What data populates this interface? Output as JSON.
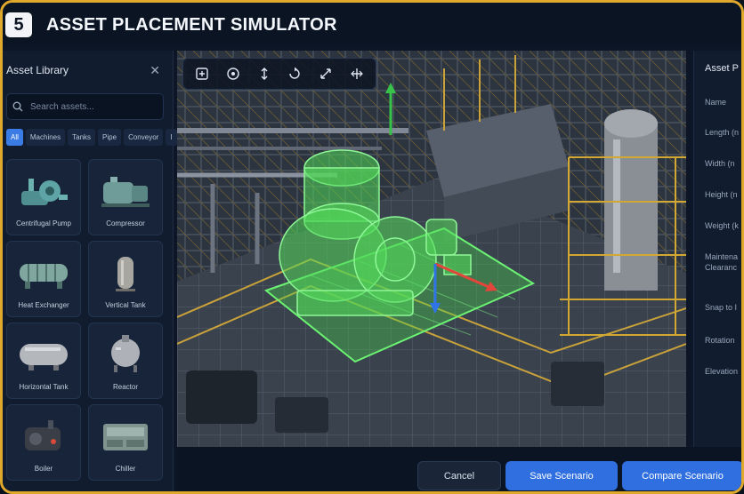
{
  "app": {
    "badge": "5",
    "title": "ASSET PLACEMENT SIMULATOR"
  },
  "library": {
    "title": "Asset Library",
    "search_placeholder": "Search assets...",
    "filters": [
      "All",
      "Machines",
      "Tanks",
      "Pipe",
      "Conveyor",
      "I"
    ],
    "items": [
      {
        "label": "Centrifugal Pump",
        "icon": "pump-icon"
      },
      {
        "label": "Compressor",
        "icon": "compressor-icon"
      },
      {
        "label": "Heat Exchanger",
        "icon": "heat-exchanger-icon"
      },
      {
        "label": "Vertical Tank",
        "icon": "vertical-tank-icon"
      },
      {
        "label": "Horizontal Tank",
        "icon": "horizontal-tank-icon"
      },
      {
        "label": "Reactor",
        "icon": "reactor-icon"
      },
      {
        "label": "Boiler",
        "icon": "boiler-icon"
      },
      {
        "label": "Chiller",
        "icon": "chiller-icon"
      }
    ]
  },
  "toolbar": {
    "tools": [
      "add-icon",
      "target-icon",
      "move-icon",
      "rotate-icon",
      "scale-icon",
      "snap-icon"
    ]
  },
  "properties": {
    "title": "Asset P",
    "fields": [
      "Name",
      "Length (n",
      "Width (n",
      "Height (n",
      "Weight (k",
      "Maintena",
      "Clearanc",
      "Snap to I",
      "Rotation",
      "Elevation"
    ]
  },
  "footer": {
    "cancel_label": "Cancel",
    "save_label": "Save Scenario",
    "compare_label": "Compare Scenario"
  },
  "colors": {
    "frame": "#e0a92b",
    "accent": "#2f6fe0",
    "placement": "#4fe05a",
    "axis_x": "#e2463b",
    "axis_y": "#38c24a",
    "axis_z": "#2f74e6"
  }
}
